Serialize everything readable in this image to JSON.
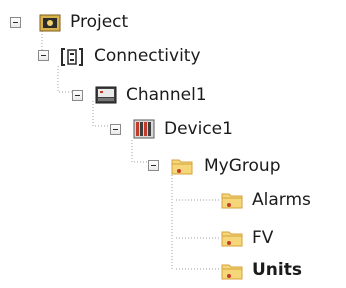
{
  "tree": {
    "nodes": [
      {
        "id": "project",
        "label": "Project",
        "icon": "project-icon",
        "expanded": true,
        "level": 0
      },
      {
        "id": "connectivity",
        "label": "Connectivity",
        "icon": "connectivity-icon",
        "expanded": true,
        "level": 1
      },
      {
        "id": "channel1",
        "label": "Channel1",
        "icon": "channel-icon",
        "expanded": true,
        "level": 2
      },
      {
        "id": "device1",
        "label": "Device1",
        "icon": "device-icon",
        "expanded": true,
        "level": 3
      },
      {
        "id": "mygroup",
        "label": "MyGroup",
        "icon": "tag-group-folder-icon",
        "expanded": true,
        "level": 4
      },
      {
        "id": "alarms",
        "label": "Alarms",
        "icon": "tag-group-folder-icon",
        "expanded": false,
        "level": 5
      },
      {
        "id": "fv",
        "label": "FV",
        "icon": "tag-group-folder-icon",
        "expanded": false,
        "level": 5
      },
      {
        "id": "units",
        "label": "Units",
        "icon": "tag-group-folder-icon",
        "expanded": false,
        "level": 5,
        "selected": true
      }
    ]
  },
  "colors": {
    "tree_line": "#a0a0a0",
    "folder_fill": "#f5d77a",
    "folder_dark": "#d3a23a",
    "tag_red": "#c23b2b"
  }
}
